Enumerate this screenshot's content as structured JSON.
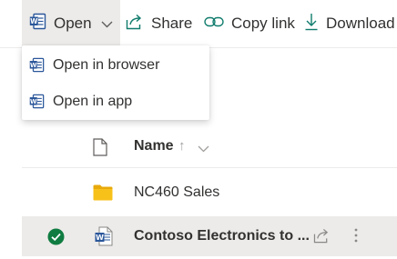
{
  "commandbar": {
    "open_label": "Open",
    "share_label": "Share",
    "copy_link_label": "Copy link",
    "download_label": "Download"
  },
  "open_menu": {
    "items": [
      {
        "label": "Open in browser",
        "icon": "word-icon"
      },
      {
        "label": "Open in app",
        "icon": "word-icon"
      }
    ]
  },
  "list": {
    "header": {
      "name_label": "Name",
      "sort_glyph": "↑"
    },
    "rows": [
      {
        "name": "NC460 Sales",
        "icon": "folder-icon",
        "selected": false
      },
      {
        "name": "Contoso Electronics to ...",
        "icon": "word-doc-icon",
        "selected": true
      }
    ]
  },
  "colors": {
    "word_blue": "#2b579a",
    "accent_teal": "#0f7b6c",
    "check_green": "#107c41",
    "folder_yellow": "#f8c11a",
    "selected_bg": "#edebe9"
  }
}
